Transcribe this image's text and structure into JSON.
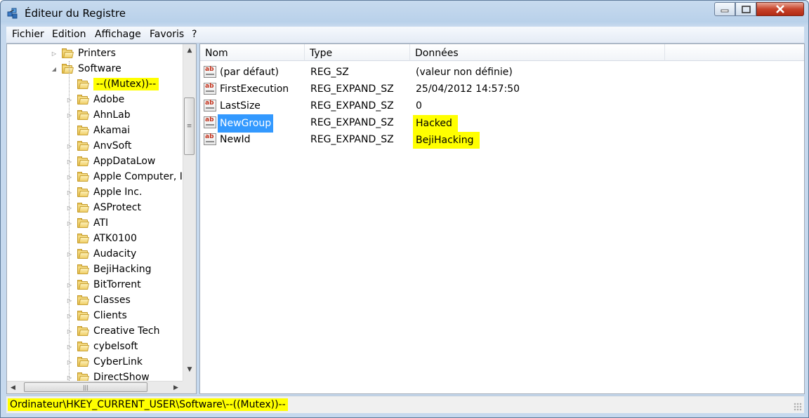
{
  "window": {
    "title": "Éditeur du Registre"
  },
  "menu": [
    "Fichier",
    "Edition",
    "Affichage",
    "Favoris",
    "?"
  ],
  "tree": {
    "items": [
      {
        "label": "Printers",
        "expander": "▷",
        "highlight": false
      },
      {
        "label": "Software",
        "expander": "◢",
        "highlight": false
      },
      {
        "label": "--((Mutex))--",
        "expander": "",
        "highlight": true
      },
      {
        "label": "Adobe",
        "expander": "▷",
        "highlight": false
      },
      {
        "label": "AhnLab",
        "expander": "▷",
        "highlight": false
      },
      {
        "label": "Akamai",
        "expander": "",
        "highlight": false
      },
      {
        "label": "AnvSoft",
        "expander": "▷",
        "highlight": false
      },
      {
        "label": "AppDataLow",
        "expander": "▷",
        "highlight": false
      },
      {
        "label": "Apple Computer, Ir",
        "expander": "▷",
        "highlight": false
      },
      {
        "label": "Apple Inc.",
        "expander": "▷",
        "highlight": false
      },
      {
        "label": "ASProtect",
        "expander": "▷",
        "highlight": false
      },
      {
        "label": "ATI",
        "expander": "▷",
        "highlight": false
      },
      {
        "label": "ATK0100",
        "expander": "",
        "highlight": false
      },
      {
        "label": "Audacity",
        "expander": "▷",
        "highlight": false
      },
      {
        "label": "BejiHacking",
        "expander": "",
        "highlight": false
      },
      {
        "label": "BitTorrent",
        "expander": "▷",
        "highlight": false
      },
      {
        "label": "Classes",
        "expander": "▷",
        "highlight": false
      },
      {
        "label": "Clients",
        "expander": "▷",
        "highlight": false
      },
      {
        "label": "Creative Tech",
        "expander": "▷",
        "highlight": false
      },
      {
        "label": "cybelsoft",
        "expander": "▷",
        "highlight": false
      },
      {
        "label": "CyberLink",
        "expander": "▷",
        "highlight": false
      },
      {
        "label": "DirectShow",
        "expander": "▷",
        "highlight": false
      }
    ]
  },
  "list": {
    "columns": [
      "Nom",
      "Type",
      "Données"
    ],
    "rows": [
      {
        "name": "(par défaut)",
        "type": "REG_SZ",
        "data": "(valeur non définie)",
        "selected": false,
        "highlight": false
      },
      {
        "name": "FirstExecution",
        "type": "REG_EXPAND_SZ",
        "data": "25/04/2012 14:57:50",
        "selected": false,
        "highlight": false
      },
      {
        "name": "LastSize",
        "type": "REG_EXPAND_SZ",
        "data": "0",
        "selected": false,
        "highlight": false
      },
      {
        "name": "NewGroup",
        "type": "REG_EXPAND_SZ",
        "data": "Hacked",
        "selected": true,
        "highlight": true
      },
      {
        "name": "NewId",
        "type": "REG_EXPAND_SZ",
        "data": "BejiHacking",
        "selected": false,
        "highlight": true
      }
    ]
  },
  "status": {
    "path": "Ordinateur\\HKEY_CURRENT_USER\\Software\\--((Mutex))--"
  },
  "colors": {
    "highlight": "#ffff00",
    "selection": "#3399ff",
    "close_button": "#c7432a",
    "title_bar": "#b9d1ea"
  }
}
